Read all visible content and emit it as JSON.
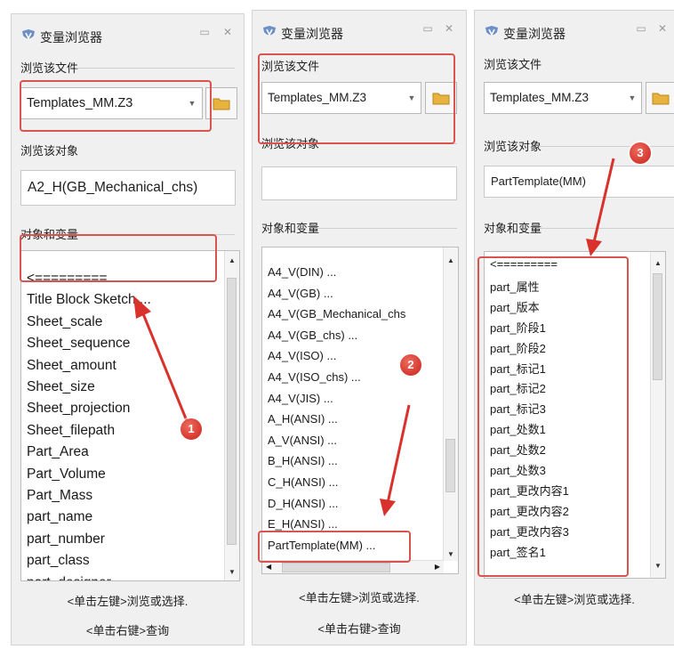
{
  "panels": [
    {
      "title": "变量浏览器",
      "file_label": "浏览该文件",
      "file_value": "Templates_MM.Z3",
      "object_label": "浏览该对象",
      "object_value": "A2_H(GB_Mechanical_chs)",
      "vars_label": "对象和变量",
      "items": [
        "<=========",
        "Title Block Sketch ...",
        "Sheet_scale",
        "Sheet_sequence",
        "Sheet_amount",
        "Sheet_size",
        "Sheet_projection",
        "Sheet_filepath",
        "Part_Area",
        "Part_Volume",
        "Part_Mass",
        "part_name",
        "part_number",
        "part_class",
        "part_designer"
      ],
      "hint_left": "<单击左键>浏览或选择.",
      "hint_right": "<单击右键>查询",
      "badge": "1"
    },
    {
      "title": "变量浏览器",
      "file_label": "浏览该文件",
      "file_value": "Templates_MM.Z3",
      "object_label": "浏览该对象",
      "object_value": "",
      "vars_label": "对象和变量",
      "items": [
        "A4_V(DIN) ...",
        "A4_V(GB) ...",
        "A4_V(GB_Mechanical_chs",
        "A4_V(GB_chs) ...",
        "A4_V(ISO) ...",
        "A4_V(ISO_chs) ...",
        "A4_V(JIS) ...",
        "A_H(ANSI) ...",
        "A_V(ANSI) ...",
        "B_H(ANSI) ...",
        "C_H(ANSI) ...",
        "D_H(ANSI) ...",
        "E_H(ANSI) ...",
        "PartTemplate(MM) ..."
      ],
      "hint_left": "<单击左键>浏览或选择.",
      "hint_right": "<单击右键>查询",
      "badge": "2"
    },
    {
      "title": "变量浏览器",
      "file_label": "浏览该文件",
      "file_value": "Templates_MM.Z3",
      "object_label": "浏览该对象",
      "object_value": "PartTemplate(MM)",
      "vars_label": "对象和变量",
      "items": [
        "<=========",
        "part_属性",
        "part_版本",
        "part_阶段1",
        "part_阶段2",
        "part_标记1",
        "part_标记2",
        "part_标记3",
        "part_处数1",
        "part_处数2",
        "part_处数3",
        "part_更改内容1",
        "part_更改内容2",
        "part_更改内容3",
        "part_签名1"
      ],
      "hint_left": "<单击左键>浏览或选择.",
      "hint_right": "",
      "badge": "3"
    }
  ],
  "icons": {
    "app": "variable-browser-icon",
    "folder": "folder-icon",
    "minimize": "minimize-icon",
    "close": "close-icon"
  },
  "colors": {
    "highlight": "#d9534f",
    "badge": "#d0281f"
  }
}
